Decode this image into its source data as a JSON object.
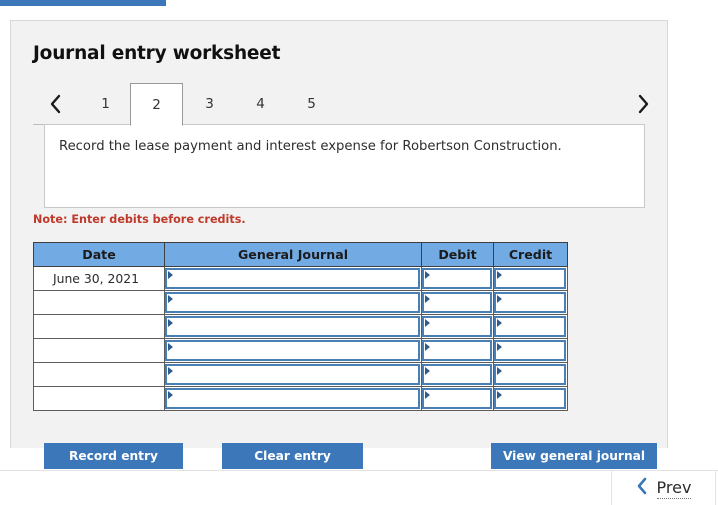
{
  "top_bar": {
    "color": "#3b77b9"
  },
  "panel": {
    "title": "Journal entry worksheet",
    "background": "#f2f2f2"
  },
  "tabs": {
    "prev_arrow_icon": "chevron-left-icon",
    "next_arrow_icon": "chevron-right-icon",
    "items": [
      {
        "label": "1",
        "active": false
      },
      {
        "label": "2",
        "active": true
      },
      {
        "label": "3",
        "active": false
      },
      {
        "label": "4",
        "active": false
      },
      {
        "label": "5",
        "active": false
      }
    ]
  },
  "instruction": {
    "text": "Record the lease payment and interest expense for Robertson Construction."
  },
  "note": {
    "text": "Note: Enter debits before credits.",
    "color": "#c0392b"
  },
  "journal_table": {
    "header_color": "#72abe3",
    "columns": [
      "Date",
      "General Journal",
      "Debit",
      "Credit"
    ],
    "rows": [
      {
        "date": "June 30, 2021",
        "general_journal": "",
        "debit": "",
        "credit": ""
      },
      {
        "date": "",
        "general_journal": "",
        "debit": "",
        "credit": ""
      },
      {
        "date": "",
        "general_journal": "",
        "debit": "",
        "credit": ""
      },
      {
        "date": "",
        "general_journal": "",
        "debit": "",
        "credit": ""
      },
      {
        "date": "",
        "general_journal": "",
        "debit": "",
        "credit": ""
      },
      {
        "date": "",
        "general_journal": "",
        "debit": "",
        "credit": ""
      }
    ]
  },
  "buttons": {
    "record_entry": "Record entry",
    "clear_entry": "Clear entry",
    "view_general_journal": "View general journal",
    "color": "#3b77b9"
  },
  "footer": {
    "prev_label": "Prev",
    "prev_icon": "chevron-left-icon",
    "prev_icon_color": "#3b77b9"
  }
}
